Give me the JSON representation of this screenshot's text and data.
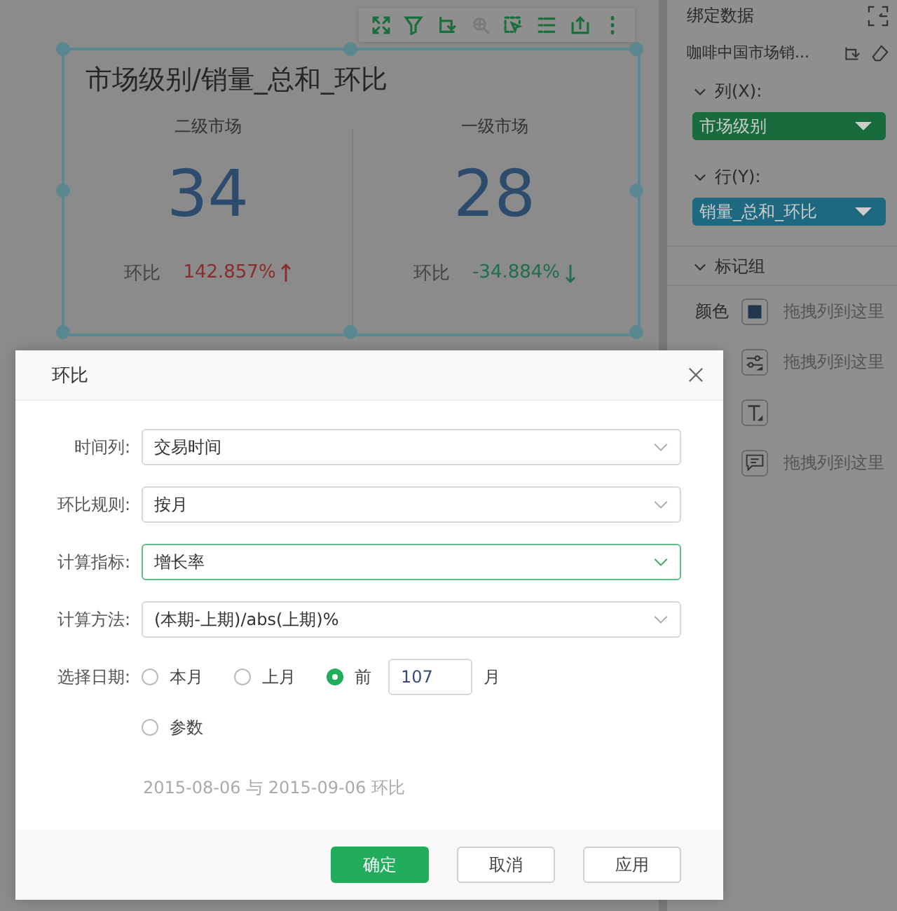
{
  "toolbar": [
    {
      "kind": "expand",
      "disabled": false
    },
    {
      "kind": "filter",
      "disabled": false
    },
    {
      "kind": "swap",
      "disabled": false
    },
    {
      "kind": "zoom",
      "disabled": true
    },
    {
      "kind": "select",
      "disabled": false
    },
    {
      "kind": "list",
      "disabled": false
    },
    {
      "kind": "export",
      "disabled": false
    },
    {
      "kind": "more",
      "disabled": false
    }
  ],
  "card": {
    "title": "市场级别/销量_总和_环比",
    "metrics": [
      {
        "label": "二级市场",
        "value": "34",
        "compare_label": "环比",
        "change": "142.857%",
        "rising": true
      },
      {
        "label": "一级市场",
        "value": "28",
        "compare_label": "环比",
        "change": "-34.884%",
        "rising": false
      }
    ]
  },
  "panel": {
    "title": "绑定数据",
    "dataset": "咖啡中国市场销...",
    "columns": {
      "label": "列(X):",
      "expanded": true,
      "field": "市场级别",
      "color": "#186b3c"
    },
    "rows": {
      "label": "行(Y):",
      "expanded": true,
      "field": "销量_总和_环比",
      "color": "#1e6880"
    },
    "marks": {
      "label": "标记组",
      "expanded": true,
      "items": [
        {
          "kind": "color",
          "label": "颜色",
          "placeholder": "拖拽列到这里"
        },
        {
          "kind": "size",
          "placeholder": "拖拽列到这里"
        },
        {
          "kind": "text"
        },
        {
          "kind": "tooltip",
          "placeholder": "拖拽列到这里"
        }
      ]
    }
  },
  "dialog": {
    "title": "环比",
    "fields": [
      {
        "label": "时间列:",
        "value": "交易时间",
        "focused": false
      },
      {
        "label": "环比规则:",
        "value": "按月",
        "focused": false
      },
      {
        "label": "计算指标:",
        "value": "增长率",
        "focused": true
      },
      {
        "label": "计算方法:",
        "value": "(本期-上期)/abs(上期)%",
        "focused": false
      }
    ],
    "date": {
      "label": "选择日期:",
      "options": [
        {
          "label": "本月",
          "selected": false
        },
        {
          "label": "上月",
          "selected": false
        },
        {
          "label": "前",
          "selected": true,
          "input": "107",
          "suffix": "月"
        },
        {
          "label": "参数",
          "selected": false
        }
      ]
    },
    "summary": "2015-08-06 与 2015-09-06 环比",
    "buttons": [
      {
        "label": "确定",
        "kind": "primary"
      },
      {
        "label": "取消",
        "kind": "default"
      },
      {
        "label": "应用",
        "kind": "default"
      }
    ]
  }
}
